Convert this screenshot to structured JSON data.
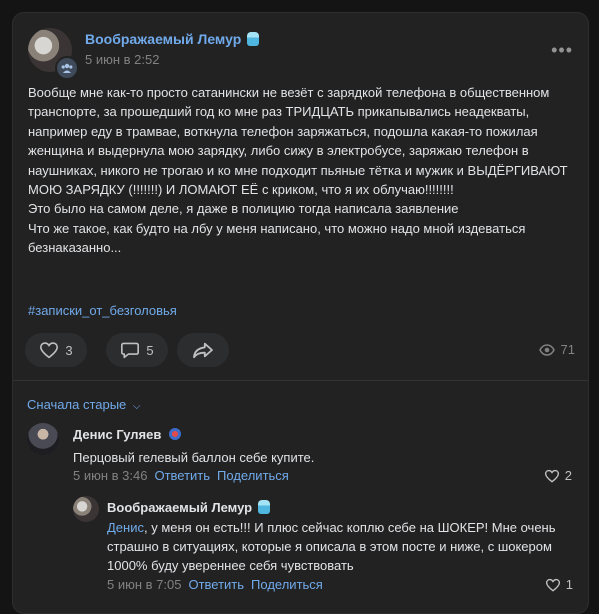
{
  "post": {
    "author": "Воображаемый Лемур",
    "date": "5 июн в 2:52",
    "text": [
      "Вообще мне как-то просто сатанински не везёт с зарядкой телефона в общественном транспорте, за прошедший год ко мне раз ТРИДЦАТЬ прикапывались неадекваты, например еду в трамвае, воткнула телефон заряжаться, подошла какая-то пожилая женщина и выдернула мою зарядку, либо сижу в электробусе, заряжаю телефон в наушниках, никого не трогаю и ко мне подходит пьяные тётка и мужик и ВЫДЁРГИВАЮТ МОЮ ЗАРЯДКУ (!!!!!!!) И ЛОМАЮТ ЕЁ с криком, что я их облучаю!!!!!!!!",
      "Это было на самом деле, я даже в полицию тогда написала заявление",
      "Что же такое, как будто на лбу у меня написано, что можно надо мной издеваться безнаказанно..."
    ],
    "hashtag": "#записки_от_безголовья",
    "likes": "3",
    "comments": "5",
    "views": "71"
  },
  "comments_section": {
    "sort_label": "Сначала старые"
  },
  "comments": [
    {
      "author": "Денис Гуляев",
      "text": "Перцовый гелевый баллон себе купите.",
      "date": "5 июн в 3:46",
      "reply_label": "Ответить",
      "share_label": "Поделиться",
      "likes": "2"
    },
    {
      "author": "Воображаемый Лемур",
      "mention": "Денис",
      "text": ", у меня он есть!!! И плюс сейчас коплю себе на ШОКЕР! Мне очень страшно в ситуациях, которые я описала в этом посте и ниже, с шокером 1000% буду увереннее себя чувствовать",
      "date": "5 июн в 7:05",
      "reply_label": "Ответить",
      "share_label": "Поделиться",
      "likes": "1"
    }
  ]
}
